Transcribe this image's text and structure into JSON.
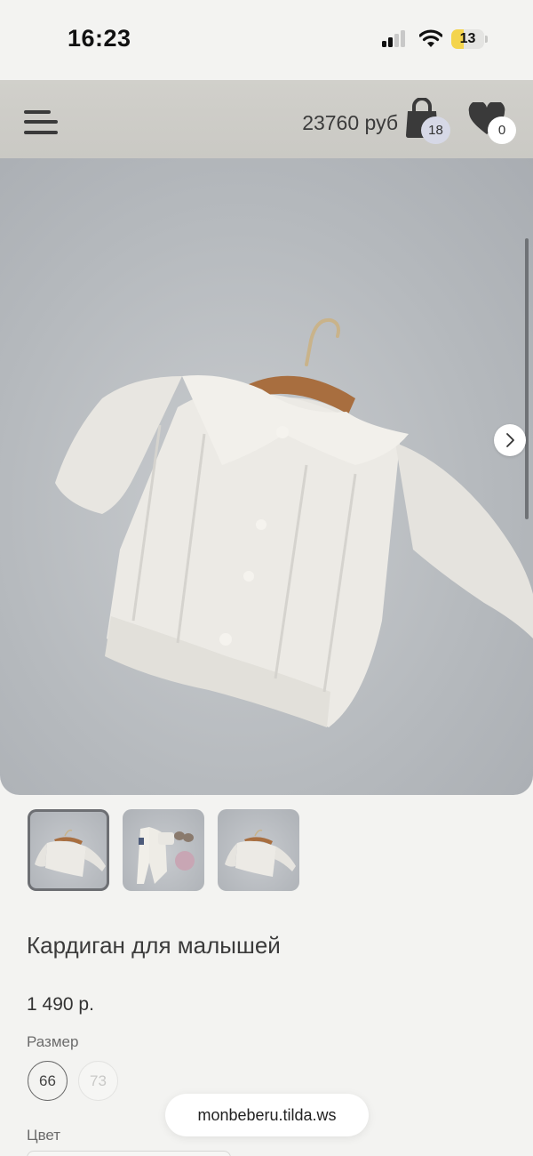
{
  "status_bar": {
    "time": "16:23",
    "battery_level": "13",
    "battery_fraction": 0.13,
    "icons": [
      "signal-icon",
      "wifi-icon",
      "battery-icon"
    ]
  },
  "header": {
    "menu_icon": "hamburger-menu-icon",
    "cart_total": "23760 руб",
    "cart_icon": "shopping-bag-icon",
    "cart_count": "18",
    "wishlist_icon": "heart-icon",
    "wishlist_count": "0"
  },
  "gallery": {
    "image": "white knitted baby cardigan on wooden hanger",
    "next_icon": "chevron-right-icon",
    "thumbnails": [
      {
        "image": "cardigan on hanger",
        "active": true
      },
      {
        "image": "baby outfit set with shoes and hat",
        "active": false
      },
      {
        "image": "cardigan on hanger",
        "active": false
      }
    ]
  },
  "product": {
    "title": "Кардиган для малышей",
    "price": "1 490 р.",
    "size_label": "Размер",
    "sizes": [
      {
        "value": "66",
        "selected": true,
        "available": true
      },
      {
        "value": "73",
        "selected": false,
        "available": false
      }
    ],
    "color_label": "Цвет"
  },
  "browser": {
    "url": "monbeberu.tilda.ws"
  },
  "colors": {
    "background": "#f3f3f1",
    "header": "#cbcac5",
    "cart_badge": "#d6d8e6",
    "battery": "#f4d44d"
  }
}
